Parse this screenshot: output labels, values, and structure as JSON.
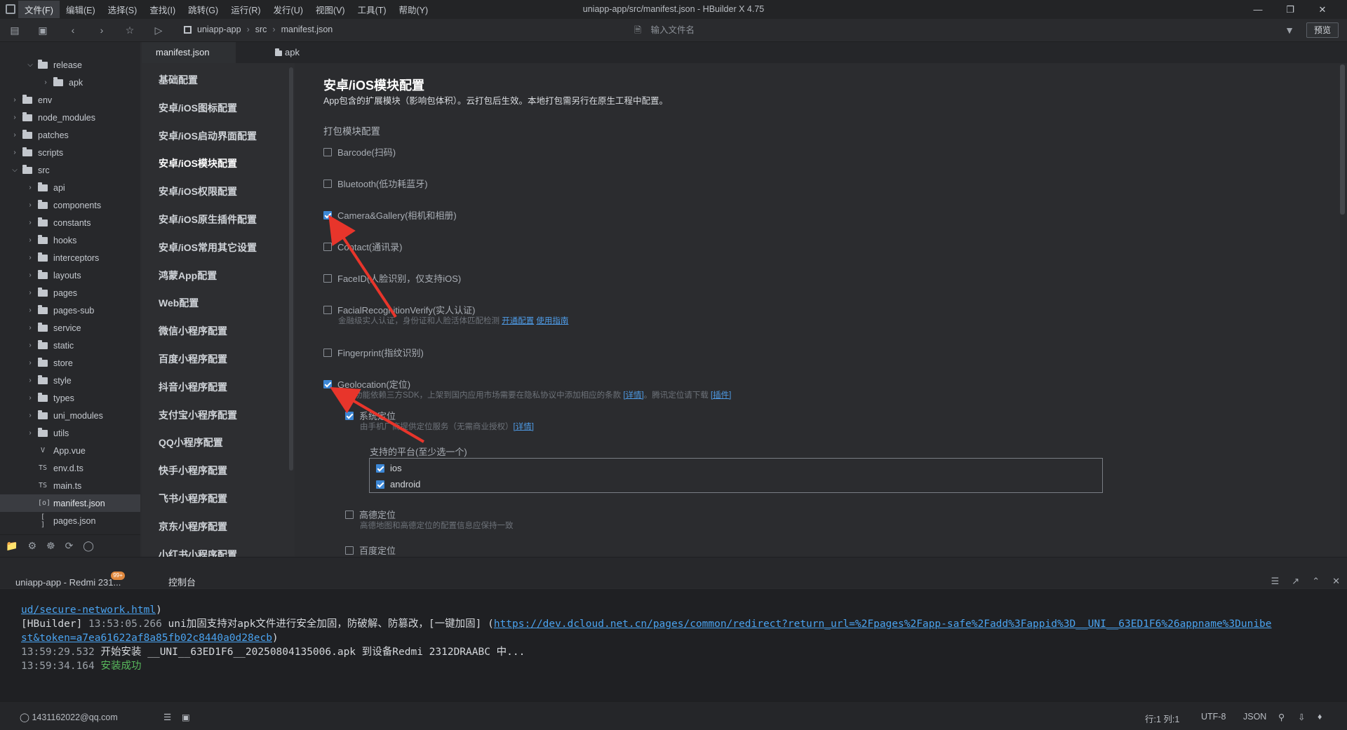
{
  "window": {
    "title": "uniapp-app/src/manifest.json - HBuilder X 4.75",
    "menu": [
      "文件(F)",
      "编辑(E)",
      "选择(S)",
      "查找(I)",
      "跳转(G)",
      "运行(R)",
      "发行(U)",
      "视图(V)",
      "工具(T)",
      "帮助(Y)"
    ]
  },
  "toolbar": {
    "breadcrumb": [
      "uniapp-app",
      "src",
      "manifest.json"
    ],
    "search_placeholder": "输入文件名",
    "preview_label": "预览"
  },
  "filetree": {
    "items": [
      {
        "label": "release",
        "depth": 2,
        "type": "folder",
        "expanded": true
      },
      {
        "label": "apk",
        "depth": 3,
        "type": "folder",
        "expanded": false
      },
      {
        "label": "env",
        "depth": 1,
        "type": "folder",
        "expanded": false
      },
      {
        "label": "node_modules",
        "depth": 1,
        "type": "folder",
        "expanded": false
      },
      {
        "label": "patches",
        "depth": 1,
        "type": "folder",
        "expanded": false
      },
      {
        "label": "scripts",
        "depth": 1,
        "type": "folder",
        "expanded": false
      },
      {
        "label": "src",
        "depth": 1,
        "type": "folder",
        "expanded": true
      },
      {
        "label": "api",
        "depth": 2,
        "type": "folder",
        "expanded": false
      },
      {
        "label": "components",
        "depth": 2,
        "type": "folder",
        "expanded": false
      },
      {
        "label": "constants",
        "depth": 2,
        "type": "folder",
        "expanded": false
      },
      {
        "label": "hooks",
        "depth": 2,
        "type": "folder",
        "expanded": false
      },
      {
        "label": "interceptors",
        "depth": 2,
        "type": "folder",
        "expanded": false
      },
      {
        "label": "layouts",
        "depth": 2,
        "type": "folder",
        "expanded": false
      },
      {
        "label": "pages",
        "depth": 2,
        "type": "folder",
        "expanded": false
      },
      {
        "label": "pages-sub",
        "depth": 2,
        "type": "folder",
        "expanded": false
      },
      {
        "label": "service",
        "depth": 2,
        "type": "folder",
        "expanded": false
      },
      {
        "label": "static",
        "depth": 2,
        "type": "folder",
        "expanded": false
      },
      {
        "label": "store",
        "depth": 2,
        "type": "folder",
        "expanded": false
      },
      {
        "label": "style",
        "depth": 2,
        "type": "folder",
        "expanded": false
      },
      {
        "label": "types",
        "depth": 2,
        "type": "folder",
        "expanded": false
      },
      {
        "label": "uni_modules",
        "depth": 2,
        "type": "folder",
        "expanded": false
      },
      {
        "label": "utils",
        "depth": 2,
        "type": "folder",
        "expanded": false
      },
      {
        "label": "App.vue",
        "depth": 2,
        "type": "file",
        "icon": "V"
      },
      {
        "label": "env.d.ts",
        "depth": 2,
        "type": "file",
        "icon": "TS"
      },
      {
        "label": "main.ts",
        "depth": 2,
        "type": "file",
        "icon": "TS"
      },
      {
        "label": "manifest.json",
        "depth": 2,
        "type": "file",
        "icon": "[o]",
        "selected": true
      },
      {
        "label": "pages.json",
        "depth": 2,
        "type": "file",
        "icon": "[ ]"
      }
    ]
  },
  "tabs": [
    {
      "label": "manifest.json",
      "active": true
    },
    {
      "label": "apk",
      "active": false
    }
  ],
  "confnav": {
    "items": [
      "基础配置",
      "安卓/iOS图标配置",
      "安卓/iOS启动界面配置",
      "安卓/iOS模块配置",
      "安卓/iOS权限配置",
      "安卓/iOS原生插件配置",
      "安卓/iOS常用其它设置",
      "鸿蒙App配置",
      "Web配置",
      "微信小程序配置",
      "百度小程序配置",
      "抖音小程序配置",
      "支付宝小程序配置",
      "QQ小程序配置",
      "快手小程序配置",
      "飞书小程序配置",
      "京东小程序配置",
      "小红书小程序配置"
    ],
    "current_index": 3
  },
  "main": {
    "title": "安卓/iOS模块配置",
    "subtitle": "App包含的扩展模块（影响包体积）。云打包后生效。本地打包需另行在原生工程中配置。",
    "section_title": "打包模块配置",
    "options": [
      {
        "label": "Barcode(扫码)",
        "checked": false
      },
      {
        "label": "Bluetooth(低功耗蓝牙)",
        "checked": false
      },
      {
        "label": "Camera&Gallery(相机和相册)",
        "checked": true
      },
      {
        "label": "Contact(通讯录)",
        "checked": false
      },
      {
        "label": "FaceID(人脸识别，仅支持iOS)",
        "checked": false
      },
      {
        "label": "FacialRecognitionVerify(实人认证)",
        "checked": false
      },
      {
        "label": "Fingerprint(指纹识别)",
        "checked": false
      },
      {
        "label": "Geolocation(定位)",
        "checked": true
      }
    ],
    "facial_hint": "金融级实人认证，身份证和人脸活体匹配检测",
    "facial_link1": "开通配置",
    "facial_link2": "使用指南",
    "geo_hint": "定位功能依赖三方SDK，上架到国内应用市场需要在隐私协议中添加相应的条款",
    "geo_link1": "[详情]",
    "geo_hint2": "。腾讯定位请下载",
    "geo_link2": "[插件]",
    "sys_loc_label": "系统定位",
    "sys_loc_checked": true,
    "sys_loc_hint": "由手机厂商提供定位服务（无需商业授权）",
    "sys_loc_link": "[详情]",
    "platform_title": "支持的平台(至少选一个)",
    "platforms": [
      {
        "label": "ios",
        "checked": true
      },
      {
        "label": "android",
        "checked": true
      }
    ],
    "amap_label": "高德定位",
    "amap_checked": false,
    "amap_hint": "高德地图和高德定位的配置信息应保持一致",
    "baidu_label": "百度定位",
    "baidu_checked": false
  },
  "console": {
    "device_tab": "uniapp-app - Redmi 231...",
    "badge": "99+",
    "tab_label": "控制台",
    "lines": {
      "l1_link": "ud/secure-network.html",
      "l1_tail": ")",
      "l2_prefix": "[HBuilder]",
      "l2_time": "13:53:05.266",
      "l2_text": "uni加固支持对apk文件进行安全加固，防破解、防篡改，[一键加固] (",
      "l2_link": "https://dev.dcloud.net.cn/pages/common/redirect?return_url=%2Fpages%2Fapp-safe%2Fadd%3Fappid%3D__UNI__63ED1F6%26appname%3Dunibe",
      "l3_link": "st&token=a7ea61622af8a85fb02c8440a0d28ecb",
      "l3_tail": ")",
      "l4_time": "13:59:29.532",
      "l4_text": "开始安装 __UNI__63ED1F6__20250804135006.apk 到设备Redmi 2312DRAABC 中...",
      "l5_time": "13:59:34.164",
      "l5_text": "安装成功"
    }
  },
  "statusbar": {
    "user": "1431162022@qq.com",
    "position": "行:1  列:1",
    "encoding": "UTF-8",
    "language": "JSON"
  },
  "colors": {
    "accent": "#3c87d6",
    "link": "#4aa3f0",
    "success": "#58b85c",
    "annotation_arrow": "#e8352b"
  }
}
